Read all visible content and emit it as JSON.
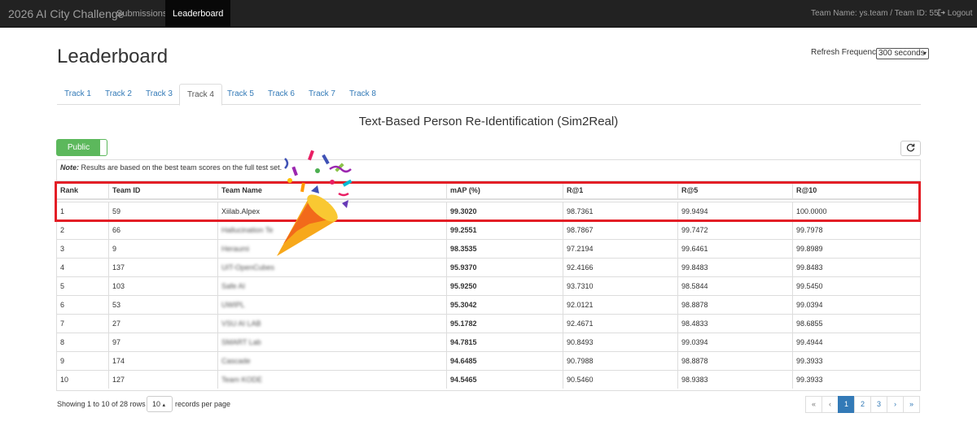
{
  "navbar": {
    "brand": "2026 AI City Challenge",
    "links": [
      "Submissions",
      "Leaderboard"
    ],
    "team_info": "Team Name: ys.team / Team ID: 55",
    "logout": "Logout"
  },
  "header": {
    "title": "Leaderboard",
    "refresh_label": "Refresh Frequency",
    "refresh_value": "300 seconds"
  },
  "tabs": [
    "Track 1",
    "Track 2",
    "Track 3",
    "Track 4",
    "Track 5",
    "Track 6",
    "Track 7",
    "Track 8"
  ],
  "active_tab": "Track 4",
  "subtitle": "Text-Based Person Re-Identification (Sim2Real)",
  "toggle_label": "Public",
  "note": {
    "bold": "Note:",
    "text": " Results are based on the best team scores on the full test set."
  },
  "table": {
    "columns": [
      "Rank",
      "Team ID",
      "Team Name",
      "mAP (%)",
      "R@1",
      "R@5",
      "R@10"
    ],
    "rows": [
      [
        "1",
        "59",
        "Xiilab.Alpex",
        "99.3020",
        "98.7361",
        "99.9494",
        "100.0000"
      ],
      [
        "2",
        "66",
        "Hallucination Te",
        "99.2551",
        "98.7867",
        "99.7472",
        "99.7978"
      ],
      [
        "3",
        "9",
        "Heraumi",
        "98.3535",
        "97.2194",
        "99.6461",
        "99.8989"
      ],
      [
        "4",
        "137",
        "UIT-OpenCubes",
        "95.9370",
        "92.4166",
        "99.8483",
        "99.8483"
      ],
      [
        "5",
        "103",
        "Safe AI",
        "95.9250",
        "93.7310",
        "98.5844",
        "99.5450"
      ],
      [
        "6",
        "53",
        "UWIPL",
        "95.3042",
        "92.0121",
        "98.8878",
        "99.0394"
      ],
      [
        "7",
        "27",
        "VSU AI LAB",
        "95.1782",
        "92.4671",
        "98.4833",
        "98.6855"
      ],
      [
        "8",
        "97",
        "SMART Lab",
        "94.7815",
        "90.8493",
        "99.0394",
        "99.4944"
      ],
      [
        "9",
        "174",
        "Cascade",
        "94.6485",
        "90.7988",
        "98.8878",
        "99.3933"
      ],
      [
        "10",
        "127",
        "Team KODE",
        "94.5465",
        "90.5460",
        "98.9383",
        "99.3933"
      ]
    ]
  },
  "footer": {
    "showing": "Showing 1 to 10 of 28 rows",
    "per_page": "10",
    "records_label": "records per page",
    "pages": [
      "«",
      "‹",
      "1",
      "2",
      "3",
      "›",
      "»"
    ],
    "current_page": "1"
  },
  "colors": {
    "highlight": "#e31e26",
    "accent": "#337ab7",
    "toggle": "#5cb85c",
    "navbar": "#222222"
  },
  "icons": [
    "logout-icon",
    "refresh-icon",
    "party-popper-icon"
  ]
}
